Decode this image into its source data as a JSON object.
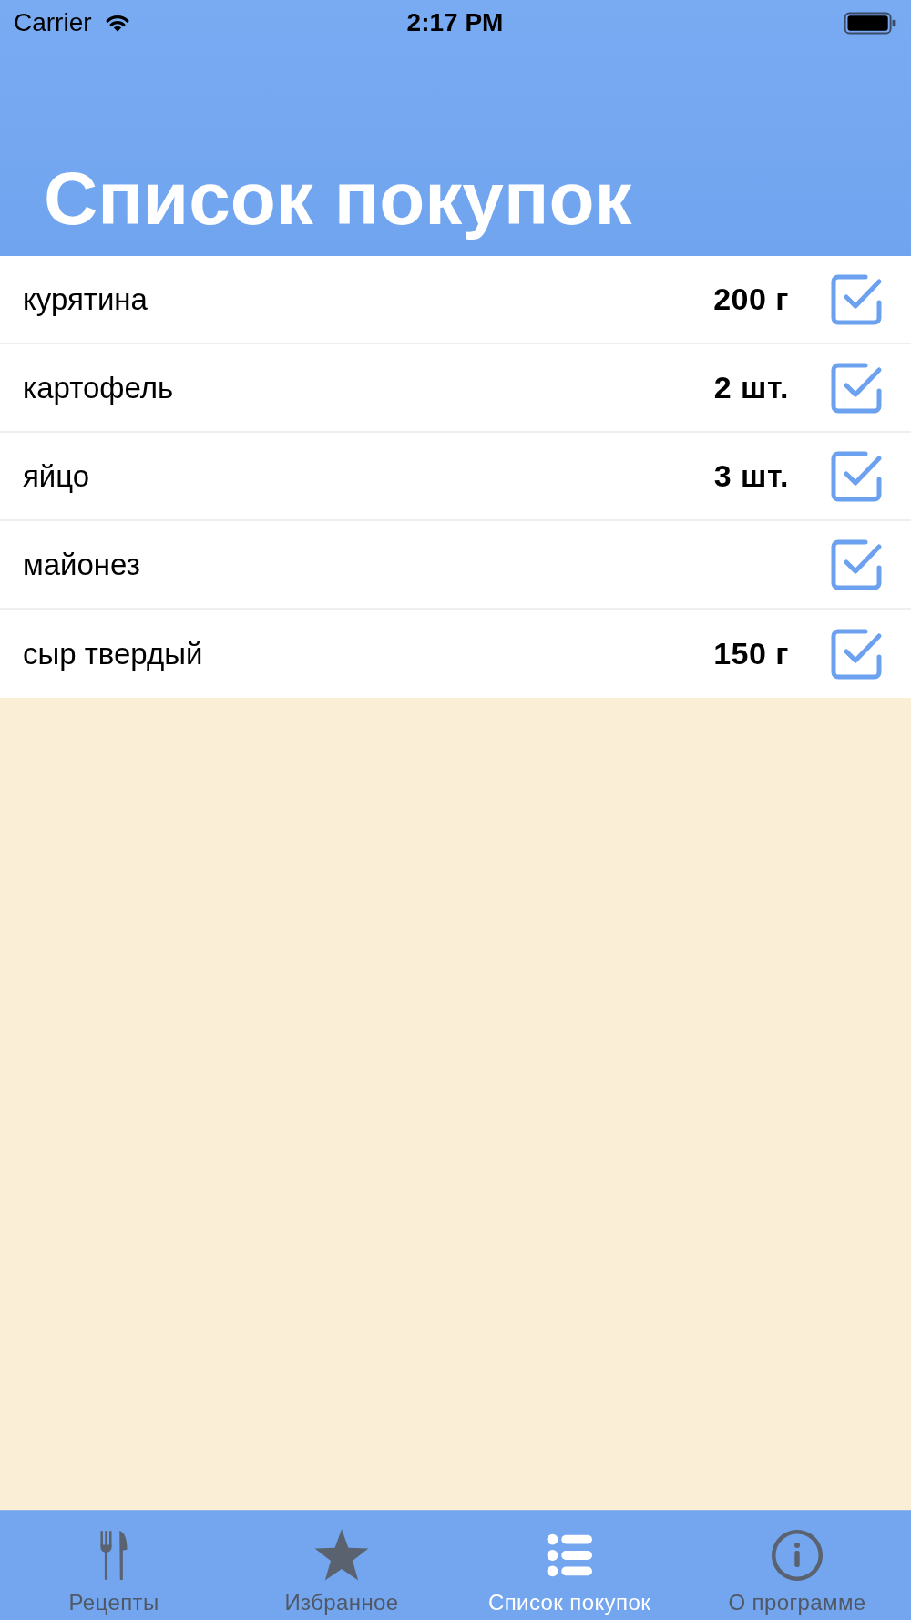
{
  "status_bar": {
    "carrier": "Carrier",
    "time": "2:17 PM"
  },
  "header": {
    "title": "Список покупок"
  },
  "items": [
    {
      "name": "курятина",
      "quantity": "200 г",
      "checked": true
    },
    {
      "name": "картофель",
      "quantity": "2 шт.",
      "checked": true
    },
    {
      "name": "яйцо",
      "quantity": "3 шт.",
      "checked": true
    },
    {
      "name": "майонез",
      "checked": true
    },
    {
      "name": "сыр твердый",
      "quantity": "150 г",
      "checked": true
    }
  ],
  "tabs": [
    {
      "label": "Рецепты",
      "selected": false
    },
    {
      "label": "Избранное",
      "selected": false
    },
    {
      "label": "Список покупок",
      "selected": true
    },
    {
      "label": "О программе",
      "selected": false
    }
  ]
}
